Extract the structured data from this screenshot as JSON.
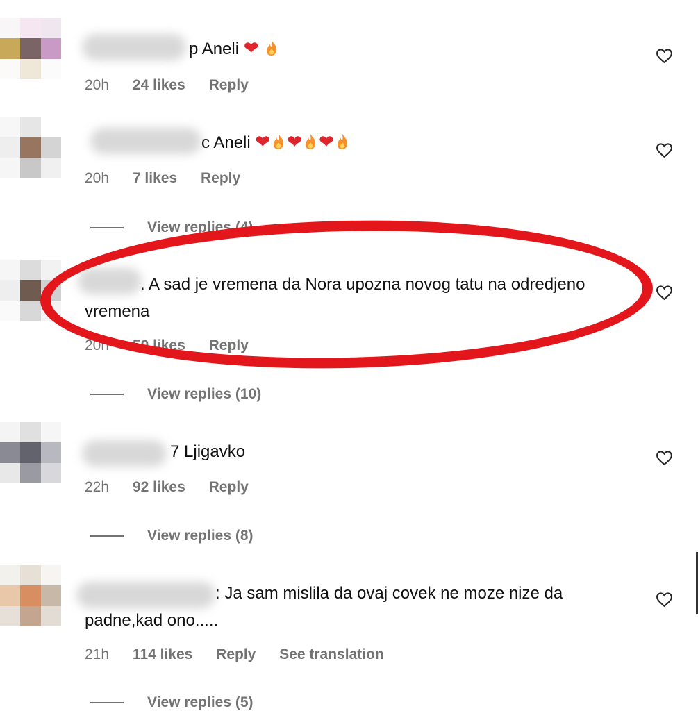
{
  "comments": [
    {
      "text": "p Aneli",
      "time": "20h",
      "likes": "24 likes",
      "reply": "Reply",
      "emoji": [
        "heart",
        "fire"
      ]
    },
    {
      "text": "c Aneli",
      "time": "20h",
      "likes": "7 likes",
      "reply": "Reply",
      "view_replies": "View replies (4)",
      "emoji": [
        "heart",
        "fire",
        "heart",
        "fire",
        "heart",
        "fire"
      ]
    },
    {
      "text": ". A sad je vremena da Nora upozna novog tatu na odredjeno vremena",
      "time": "20h",
      "likes": "50 likes",
      "reply": "Reply",
      "view_replies": "View replies (10)"
    },
    {
      "text": "7 Ljigavko",
      "time": "22h",
      "likes": "92 likes",
      "reply": "Reply",
      "view_replies": "View replies (8)"
    },
    {
      "text": ": Ja sam mislila da ovaj covek ne moze nize da padne,kad ono.....",
      "time": "21h",
      "likes": "114 likes",
      "reply": "Reply",
      "translation": "See translation",
      "view_replies": "View replies (5)"
    }
  ],
  "colors": {
    "annotation": "#e3161c",
    "meta": "#737373",
    "heart": "#e0242c",
    "fire": "#f5902a"
  },
  "icons": {
    "like": "heart-outline-icon",
    "emoji_heart": "red-heart-emoji",
    "emoji_fire": "fire-emoji"
  }
}
